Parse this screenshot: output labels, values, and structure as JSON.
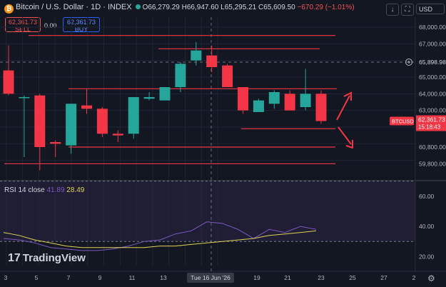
{
  "header": {
    "title": "Bitcoin / U.S. Dollar · 1D · INDEX",
    "open": "O66,279.29",
    "high": "H66,947.60",
    "low": "L65,295.21",
    "close": "C65,609.50",
    "change": "−670.29 (−1.01%)"
  },
  "trade": {
    "sell_price": "62,361.73",
    "sell_label": "SELL",
    "spread": "0.00",
    "buy_price": "62,361.73",
    "buy_label": "BUY"
  },
  "toolbar": {
    "download_icon": "download-icon",
    "fullscreen_icon": "fullscreen-icon",
    "currency": "USD"
  },
  "price_axis": {
    "labels": [
      "68,000.00",
      "67,000.00",
      "65,898.98",
      "65,000.00",
      "64,000.00",
      "63,000.00",
      "62,361.73",
      "60,800.00",
      "59,800.00"
    ],
    "last_symbol": "BTCUSD",
    "last_price": "62,361.73",
    "countdown": "15:18:43"
  },
  "rsi": {
    "label": "RSI 14 close",
    "value1": "41.89",
    "value2": "28.49",
    "axis_labels": [
      "60.00",
      "40.00",
      "20.00"
    ]
  },
  "time_axis": {
    "labels": [
      "3",
      "5",
      "7",
      "9",
      "11",
      "13",
      "Tue 16 Jun '26",
      "19",
      "21",
      "23",
      "25",
      "27",
      "2"
    ]
  },
  "logo": "TradingView",
  "colors": {
    "up": "#26a69a",
    "down": "#f23645",
    "line": "#f23645",
    "rsi_line": "#7e57c2",
    "rsi_ma": "#e2d055",
    "background": "#131722"
  },
  "chart_data": {
    "type": "candlestick",
    "interval": "1D",
    "candles": [
      {
        "open": 65400,
        "high": 66900,
        "low": 63900,
        "close": 64000
      },
      {
        "open": 63800,
        "high": 63900,
        "low": 60200,
        "close": 63800
      },
      {
        "open": 63900,
        "high": 64000,
        "low": 59400,
        "close": 60800
      },
      {
        "open": 61100,
        "high": 61200,
        "low": 60200,
        "close": 61000
      },
      {
        "open": 60900,
        "high": 63400,
        "low": 60400,
        "close": 63400
      },
      {
        "open": 63300,
        "high": 64300,
        "low": 62800,
        "close": 63100
      },
      {
        "open": 63100,
        "high": 63200,
        "low": 61400,
        "close": 61600
      },
      {
        "open": 61600,
        "high": 61800,
        "low": 61100,
        "close": 61500
      },
      {
        "open": 61600,
        "high": 63800,
        "low": 61300,
        "close": 63800
      },
      {
        "open": 63700,
        "high": 64100,
        "low": 63600,
        "close": 63800
      },
      {
        "open": 63600,
        "high": 64300,
        "low": 63600,
        "close": 64400
      },
      {
        "open": 64400,
        "high": 65900,
        "low": 64100,
        "close": 65800
      },
      {
        "open": 66000,
        "high": 67100,
        "low": 65700,
        "close": 66600
      },
      {
        "open": 66300,
        "high": 66900,
        "low": 65300,
        "close": 65600
      },
      {
        "open": 65700,
        "high": 65800,
        "low": 64400,
        "close": 64400
      },
      {
        "open": 64400,
        "high": 64400,
        "low": 62800,
        "close": 63000
      },
      {
        "open": 62900,
        "high": 63700,
        "low": 62900,
        "close": 63600
      },
      {
        "open": 63400,
        "high": 64200,
        "low": 63100,
        "close": 64100
      },
      {
        "open": 64000,
        "high": 64200,
        "low": 63000,
        "close": 63000
      },
      {
        "open": 63200,
        "high": 65500,
        "low": 63000,
        "close": 64000
      },
      {
        "open": 64000,
        "high": 64200,
        "low": 62200,
        "close": 62361.73
      }
    ],
    "horizontal_levels": [
      67500,
      66700,
      64300,
      61900,
      60800,
      59800
    ],
    "rsi_series": [
      32,
      31,
      29,
      26,
      25,
      24,
      24,
      25,
      27,
      30,
      31,
      35,
      37,
      43,
      42,
      38,
      32,
      38,
      36,
      40,
      38
    ],
    "rsi_ma_series": [
      36,
      34,
      31,
      29,
      27,
      26,
      26,
      26,
      26,
      26,
      27,
      27,
      28,
      29,
      30,
      31,
      32,
      34,
      35,
      36,
      37
    ],
    "price_range": [
      59000,
      68600
    ],
    "rsi_range": [
      14,
      68
    ]
  }
}
